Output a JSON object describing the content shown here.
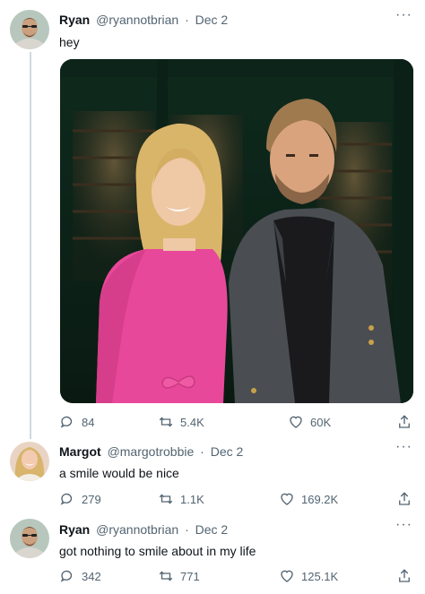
{
  "tweets": [
    {
      "author": "Ryan",
      "handle": "@ryannotbrian",
      "date": "Dec 2",
      "text": "hey",
      "replies": "84",
      "retweets": "5.4K",
      "likes": "60K"
    },
    {
      "author": "Margot",
      "handle": "@margotrobbie",
      "date": "Dec 2",
      "text": "a smile would be nice",
      "replies": "279",
      "retweets": "1.1K",
      "likes": "169.2K"
    },
    {
      "author": "Ryan",
      "handle": "@ryannotbrian",
      "date": "Dec 2",
      "text": "got nothing to smile about in my life",
      "replies": "342",
      "retweets": "771",
      "likes": "125.1K"
    }
  ],
  "separator": "·",
  "more_glyph": "···",
  "icons": [
    "reply-icon",
    "retweet-icon",
    "like-icon",
    "share-icon",
    "more-icon"
  ],
  "colors": {
    "text": "#0f1419",
    "secondary": "#536471",
    "thread_line": "#cfd9de",
    "photo_bg": "#10271c",
    "dress": "#e8489a"
  }
}
